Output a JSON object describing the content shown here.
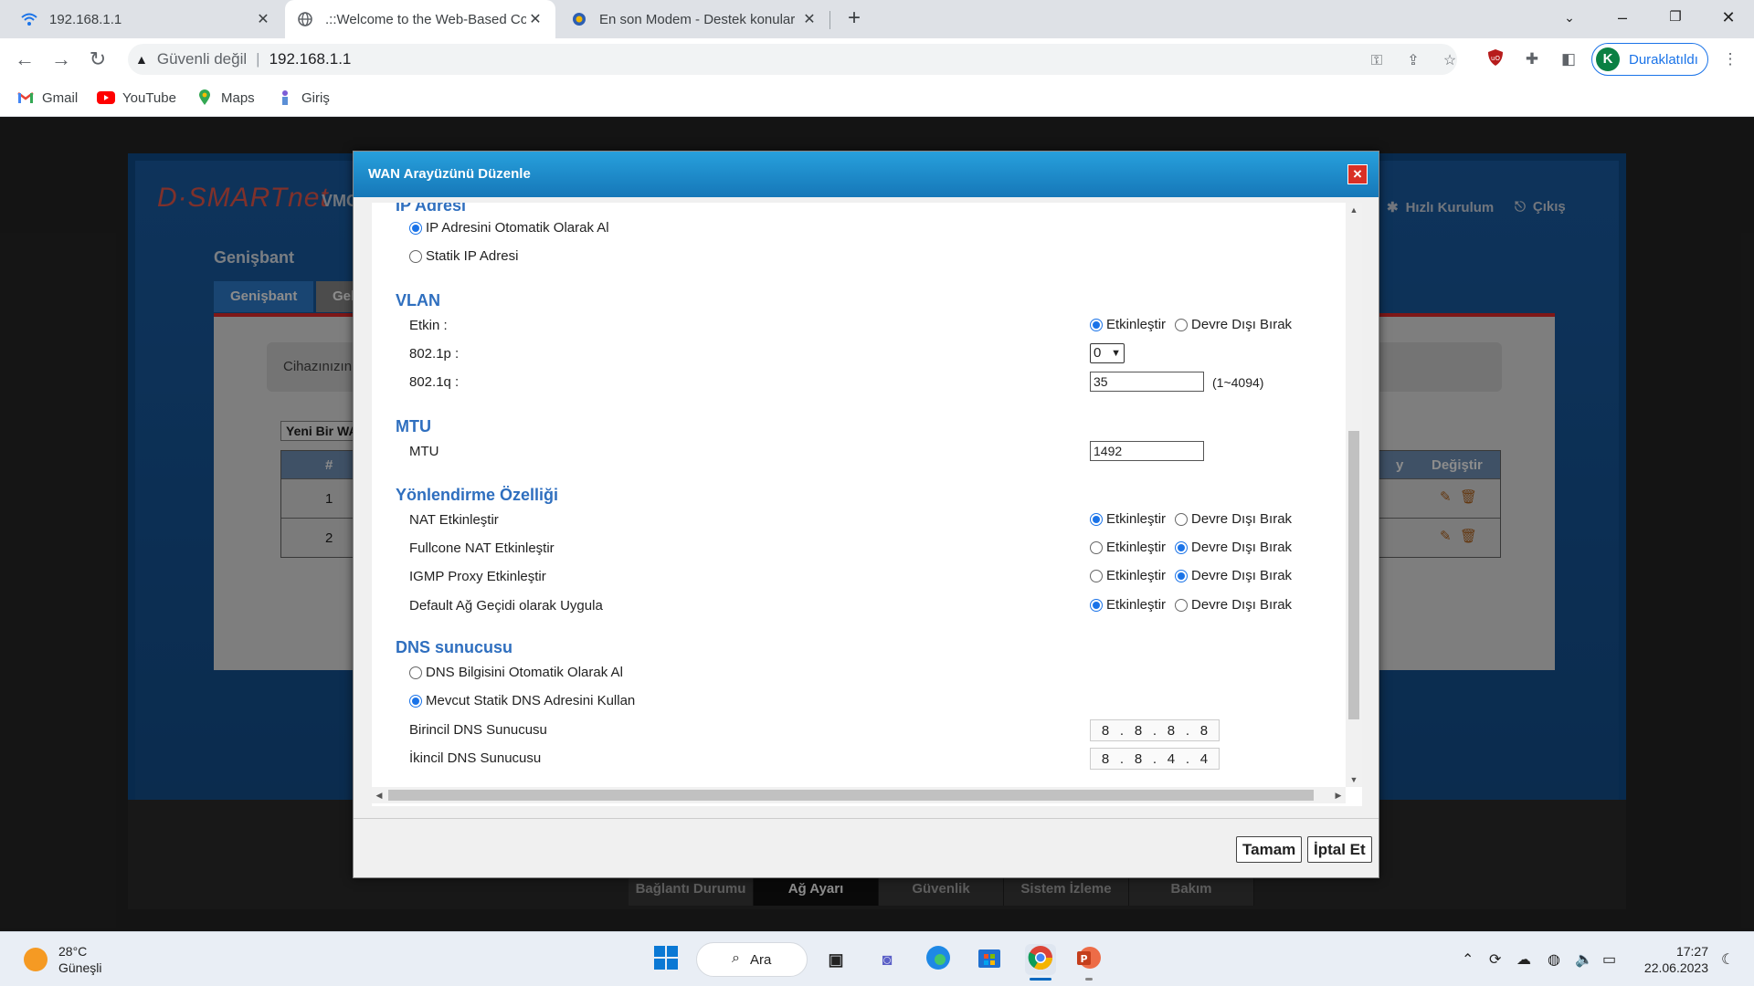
{
  "browser": {
    "tabs": [
      {
        "title": "192.168.1.1",
        "icon": "wifi-icon",
        "close": "✕"
      },
      {
        "title": ".::Welcome to the Web-Based Co",
        "icon": "globe-icon",
        "close": "✕"
      },
      {
        "title": "En son Modem - Destek konular",
        "icon": "site-favicon-icon",
        "close": "✕"
      }
    ],
    "new_tab": "+",
    "address": {
      "not_secure": "Güvenli değil",
      "separator": "|",
      "url": "192.168.1.1"
    },
    "profile": {
      "initial": "K",
      "label": "Duraklatıldı"
    },
    "bookmarks": [
      {
        "label": "Gmail",
        "icon": "gmail-icon"
      },
      {
        "label": "YouTube",
        "icon": "youtube-icon"
      },
      {
        "label": "Maps",
        "icon": "maps-icon"
      },
      {
        "label": "Giriş",
        "icon": "bookmark-favicon-icon"
      }
    ],
    "accent": "#1a73e8"
  },
  "router": {
    "brand": "D·SMARTnet",
    "model": "VMG",
    "quick_setup": "Hızlı Kurulum",
    "logout": "Çıkış",
    "heading": "Genişbant",
    "tabs": [
      "Genişbant",
      "Gel"
    ],
    "info_text": "Cihazınızın İ",
    "new_wan_label": "Yeni Bir WA",
    "table": {
      "headers": [
        "#",
        "y",
        "Değiştir"
      ],
      "rows": [
        "1",
        "2"
      ]
    },
    "bottom_nav": [
      "Bağlantı Durumu",
      "Ağ Ayarı",
      "Güvenlik",
      "Sistem İzleme",
      "Bakım"
    ],
    "bottom_nav_selected": "Ağ Ayarı"
  },
  "modal": {
    "title": "WAN Arayüzünü Düzenle",
    "ip_section": "IP Adresi",
    "ip_options": [
      {
        "label": "IP Adresini Otomatik Olarak Al",
        "checked": true
      },
      {
        "label": "Statik IP Adresi",
        "checked": false
      }
    ],
    "vlan_section": "VLAN",
    "vlan": {
      "enabled_label": "Etkin :",
      "p_label": "802.1p :",
      "p_value": "0",
      "q_label": "802.1q :",
      "q_value": "35",
      "q_hint": "(1~4094)"
    },
    "mtu_section": "MTU",
    "mtu": {
      "label": "MTU",
      "value": "1492"
    },
    "routing_section": "Yönlendirme Özelliği",
    "routing": [
      {
        "label": "NAT Etkinleştir",
        "enabled": true
      },
      {
        "label": "Fullcone NAT Etkinleştir",
        "enabled": false
      },
      {
        "label": "IGMP Proxy Etkinleştir",
        "enabled": false
      },
      {
        "label": "Default Ağ Geçidi olarak Uygula",
        "enabled": true
      }
    ],
    "enable_text": "Etkinleştir",
    "disable_text": "Devre Dışı Bırak",
    "dns_section": "DNS sunucusu",
    "dns_options": [
      {
        "label": "DNS Bilgisini Otomatik Olarak Al",
        "checked": false
      },
      {
        "label": "Mevcut Statik DNS Adresini Kullan",
        "checked": true
      }
    ],
    "dns_primary_label": "Birincil DNS Sunucusu",
    "dns_primary": [
      "8",
      "8",
      "8",
      "8"
    ],
    "dns_secondary_label": "İkincil DNS Sunucusu",
    "dns_secondary": [
      "8",
      "8",
      "4",
      "4"
    ],
    "ok_button": "Tamam",
    "cancel_button": "İptal Et"
  },
  "taskbar": {
    "weather_temp": "28°C",
    "weather_desc": "Güneşli",
    "search_label": "Ara",
    "time": "17:27",
    "date": "22.06.2023"
  }
}
